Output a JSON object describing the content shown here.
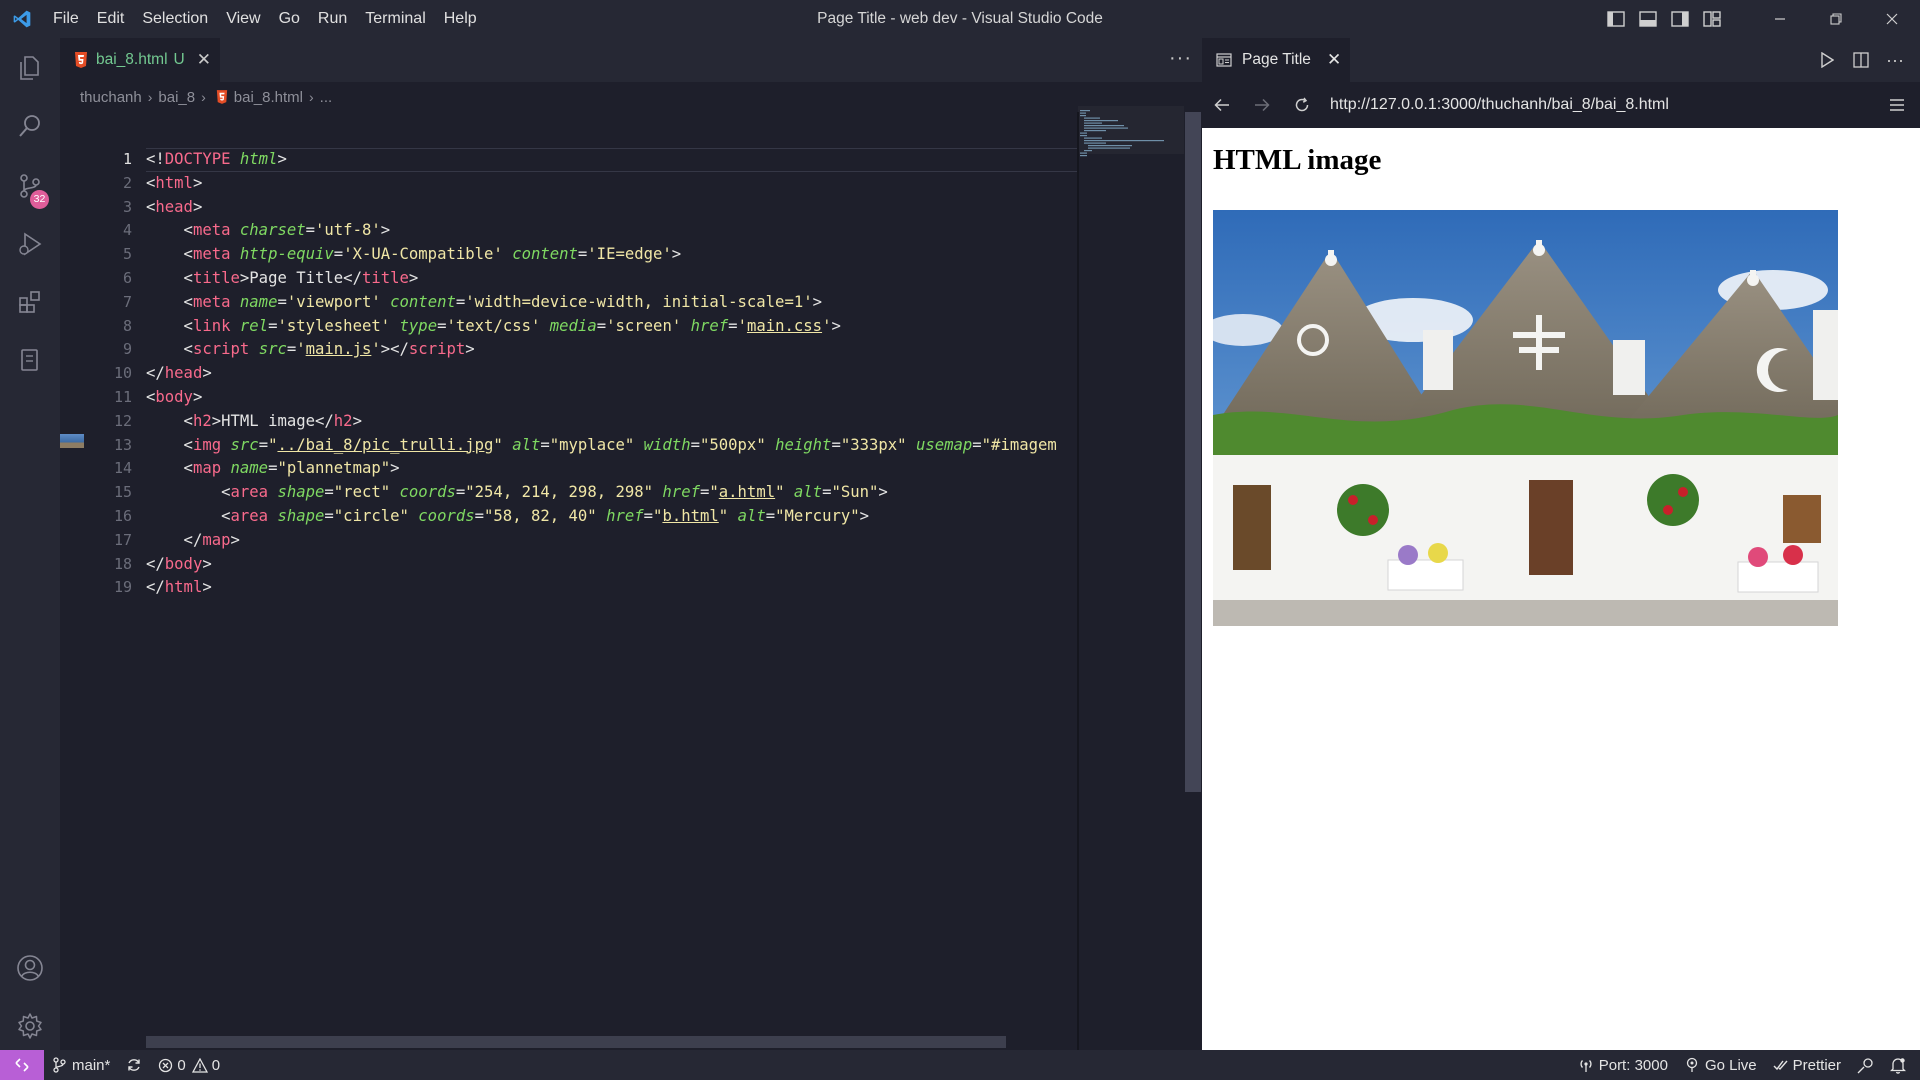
{
  "titlebar": {
    "window_title": "Page Title - web dev - Visual Studio Code",
    "menu": [
      "File",
      "Edit",
      "Selection",
      "View",
      "Go",
      "Run",
      "Terminal",
      "Help"
    ]
  },
  "activitybar": {
    "items": [
      "explorer-icon",
      "search-icon",
      "source-control-icon",
      "run-debug-icon",
      "extensions-icon",
      "remote-explorer-icon"
    ],
    "scm_badge": "32",
    "bottom": [
      "account-icon",
      "manage-gear-icon"
    ]
  },
  "editor": {
    "tab": {
      "label": "bai_8.html",
      "status": "U"
    },
    "breadcrumb": [
      "thuchanh",
      "bai_8",
      "bai_8.html",
      "..."
    ],
    "line_numbers": [
      "1",
      "2",
      "3",
      "4",
      "5",
      "6",
      "7",
      "8",
      "9",
      "10",
      "11",
      "12",
      "13",
      "14",
      "15",
      "16",
      "17",
      "18",
      "19"
    ],
    "active_line": 1,
    "lines": [
      [
        [
          "t-punc",
          "<!"
        ],
        [
          "t-tag",
          "DOCTYPE"
        ],
        [
          "t-punc",
          " "
        ],
        [
          "t-attr",
          "html"
        ],
        [
          "t-punc",
          ">"
        ]
      ],
      [
        [
          "t-punc",
          "<"
        ],
        [
          "t-tag",
          "html"
        ],
        [
          "t-punc",
          ">"
        ]
      ],
      [
        [
          "t-punc",
          "<"
        ],
        [
          "t-tag",
          "head"
        ],
        [
          "t-punc",
          ">"
        ]
      ],
      [
        [
          "t-punc",
          "    <"
        ],
        [
          "t-tag",
          "meta"
        ],
        [
          "t-punc",
          " "
        ],
        [
          "t-attr",
          "charset"
        ],
        [
          "t-punc",
          "="
        ],
        [
          "t-str",
          "'utf-8'"
        ],
        [
          "t-punc",
          ">"
        ]
      ],
      [
        [
          "t-punc",
          "    <"
        ],
        [
          "t-tag",
          "meta"
        ],
        [
          "t-punc",
          " "
        ],
        [
          "t-attr",
          "http-equiv"
        ],
        [
          "t-punc",
          "="
        ],
        [
          "t-str",
          "'X-UA-Compatible'"
        ],
        [
          "t-punc",
          " "
        ],
        [
          "t-attr",
          "content"
        ],
        [
          "t-punc",
          "="
        ],
        [
          "t-str",
          "'IE=edge'"
        ],
        [
          "t-punc",
          ">"
        ]
      ],
      [
        [
          "t-punc",
          "    <"
        ],
        [
          "t-tag",
          "title"
        ],
        [
          "t-punc",
          ">Page Title</"
        ],
        [
          "t-tag",
          "title"
        ],
        [
          "t-punc",
          ">"
        ]
      ],
      [
        [
          "t-punc",
          "    <"
        ],
        [
          "t-tag",
          "meta"
        ],
        [
          "t-punc",
          " "
        ],
        [
          "t-attr",
          "name"
        ],
        [
          "t-punc",
          "="
        ],
        [
          "t-str",
          "'viewport'"
        ],
        [
          "t-punc",
          " "
        ],
        [
          "t-attr",
          "content"
        ],
        [
          "t-punc",
          "="
        ],
        [
          "t-str",
          "'width=device-width, initial-scale=1'"
        ],
        [
          "t-punc",
          ">"
        ]
      ],
      [
        [
          "t-punc",
          "    <"
        ],
        [
          "t-tag",
          "link"
        ],
        [
          "t-punc",
          " "
        ],
        [
          "t-attr",
          "rel"
        ],
        [
          "t-punc",
          "="
        ],
        [
          "t-str",
          "'stylesheet'"
        ],
        [
          "t-punc",
          " "
        ],
        [
          "t-attr",
          "type"
        ],
        [
          "t-punc",
          "="
        ],
        [
          "t-str",
          "'text/css'"
        ],
        [
          "t-punc",
          " "
        ],
        [
          "t-attr",
          "media"
        ],
        [
          "t-punc",
          "="
        ],
        [
          "t-str",
          "'screen'"
        ],
        [
          "t-punc",
          " "
        ],
        [
          "t-attr",
          "href"
        ],
        [
          "t-punc",
          "="
        ],
        [
          "t-str",
          "'"
        ],
        [
          "t-str t-link",
          "main.css"
        ],
        [
          "t-str",
          "'"
        ],
        [
          "t-punc",
          ">"
        ]
      ],
      [
        [
          "t-punc",
          "    <"
        ],
        [
          "t-tag",
          "script"
        ],
        [
          "t-punc",
          " "
        ],
        [
          "t-attr",
          "src"
        ],
        [
          "t-punc",
          "="
        ],
        [
          "t-str",
          "'"
        ],
        [
          "t-str t-link",
          "main.js"
        ],
        [
          "t-str",
          "'"
        ],
        [
          "t-punc",
          "></"
        ],
        [
          "t-tag",
          "script"
        ],
        [
          "t-punc",
          ">"
        ]
      ],
      [
        [
          "t-punc",
          "</"
        ],
        [
          "t-tag",
          "head"
        ],
        [
          "t-punc",
          ">"
        ]
      ],
      [
        [
          "t-punc",
          "<"
        ],
        [
          "t-tag",
          "body"
        ],
        [
          "t-punc",
          ">"
        ]
      ],
      [
        [
          "t-punc",
          "    <"
        ],
        [
          "t-tag",
          "h2"
        ],
        [
          "t-punc",
          ">HTML image</"
        ],
        [
          "t-tag",
          "h2"
        ],
        [
          "t-punc",
          ">"
        ]
      ],
      [
        [
          "t-punc",
          "    <"
        ],
        [
          "t-tag",
          "img"
        ],
        [
          "t-punc",
          " "
        ],
        [
          "t-attr",
          "src"
        ],
        [
          "t-punc",
          "="
        ],
        [
          "t-str",
          "\""
        ],
        [
          "t-str t-link",
          "../bai_8/pic_trulli.jpg"
        ],
        [
          "t-str",
          "\""
        ],
        [
          "t-punc",
          " "
        ],
        [
          "t-attr",
          "alt"
        ],
        [
          "t-punc",
          "="
        ],
        [
          "t-str",
          "\"myplace\""
        ],
        [
          "t-punc",
          " "
        ],
        [
          "t-attr",
          "width"
        ],
        [
          "t-punc",
          "="
        ],
        [
          "t-str",
          "\"500px\""
        ],
        [
          "t-punc",
          " "
        ],
        [
          "t-attr",
          "height"
        ],
        [
          "t-punc",
          "="
        ],
        [
          "t-str",
          "\"333px\""
        ],
        [
          "t-punc",
          " "
        ],
        [
          "t-attr",
          "usemap"
        ],
        [
          "t-punc",
          "="
        ],
        [
          "t-str",
          "\"#imagem"
        ]
      ],
      [
        [
          "t-punc",
          "    <"
        ],
        [
          "t-tag",
          "map"
        ],
        [
          "t-punc",
          " "
        ],
        [
          "t-attr",
          "name"
        ],
        [
          "t-punc",
          "="
        ],
        [
          "t-str",
          "\"plannetmap\""
        ],
        [
          "t-punc",
          ">"
        ]
      ],
      [
        [
          "t-punc",
          "        <"
        ],
        [
          "t-tag",
          "area"
        ],
        [
          "t-punc",
          " "
        ],
        [
          "t-attr",
          "shape"
        ],
        [
          "t-punc",
          "="
        ],
        [
          "t-str",
          "\"rect\""
        ],
        [
          "t-punc",
          " "
        ],
        [
          "t-attr",
          "coords"
        ],
        [
          "t-punc",
          "="
        ],
        [
          "t-str",
          "\"254, 214, 298, 298\""
        ],
        [
          "t-punc",
          " "
        ],
        [
          "t-attr",
          "href"
        ],
        [
          "t-punc",
          "="
        ],
        [
          "t-str",
          "\""
        ],
        [
          "t-str t-link",
          "a.html"
        ],
        [
          "t-str",
          "\""
        ],
        [
          "t-punc",
          " "
        ],
        [
          "t-attr",
          "alt"
        ],
        [
          "t-punc",
          "="
        ],
        [
          "t-str",
          "\"Sun\""
        ],
        [
          "t-punc",
          ">"
        ]
      ],
      [
        [
          "t-punc",
          "        <"
        ],
        [
          "t-tag",
          "area"
        ],
        [
          "t-punc",
          " "
        ],
        [
          "t-attr",
          "shape"
        ],
        [
          "t-punc",
          "="
        ],
        [
          "t-str",
          "\"circle\""
        ],
        [
          "t-punc",
          " "
        ],
        [
          "t-attr",
          "coords"
        ],
        [
          "t-punc",
          "="
        ],
        [
          "t-str",
          "\"58, 82, 40\""
        ],
        [
          "t-punc",
          " "
        ],
        [
          "t-attr",
          "href"
        ],
        [
          "t-punc",
          "="
        ],
        [
          "t-str",
          "\""
        ],
        [
          "t-str t-link",
          "b.html"
        ],
        [
          "t-str",
          "\""
        ],
        [
          "t-punc",
          " "
        ],
        [
          "t-attr",
          "alt"
        ],
        [
          "t-punc",
          "="
        ],
        [
          "t-str",
          "\"Mercury\""
        ],
        [
          "t-punc",
          ">"
        ]
      ],
      [
        [
          "t-punc",
          "    </"
        ],
        [
          "t-tag",
          "map"
        ],
        [
          "t-punc",
          ">"
        ]
      ],
      [
        [
          "t-punc",
          "</"
        ],
        [
          "t-tag",
          "body"
        ],
        [
          "t-punc",
          ">"
        ]
      ],
      [
        [
          "t-punc",
          "</"
        ],
        [
          "t-tag",
          "html"
        ],
        [
          "t-punc",
          ">"
        ]
      ]
    ]
  },
  "browser": {
    "tab_label": "Page Title",
    "url": "http://127.0.0.1:3000/thuchanh/bai_8/bai_8.html",
    "page_heading": "HTML image",
    "image_alt": "myplace"
  },
  "statusbar": {
    "branch": "main*",
    "errors": "0",
    "warnings": "0",
    "port": "Port: 3000",
    "go_live": "Go Live",
    "prettier": "Prettier"
  },
  "colors": {
    "accent_remote": "#b85fd6",
    "badge": "#e05d9a",
    "modified_file": "#73c991"
  }
}
